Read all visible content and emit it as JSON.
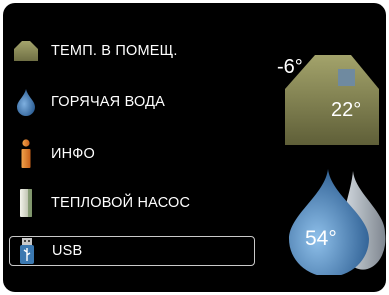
{
  "menu": {
    "items": [
      {
        "label": "ТЕМП. В ПОМЕЩ.",
        "icon": "house-icon"
      },
      {
        "label": "ГОРЯЧАЯ ВОДА",
        "icon": "water-drop-icon"
      },
      {
        "label": "ИНФО",
        "icon": "info-icon"
      },
      {
        "label": "ТЕПЛОВОЙ НАСОС",
        "icon": "heat-pump-icon"
      },
      {
        "label": "USB",
        "icon": "usb-icon",
        "selected": true
      }
    ]
  },
  "status": {
    "outdoor_temp": "-6°",
    "indoor_temp": "22°",
    "hot_water_temp": "54°"
  },
  "colors": {
    "background": "#000000",
    "house": "#8a8a58",
    "drop": "#4a7fb5",
    "info": "#e8862b",
    "selection_border": "#c9c9c9"
  }
}
